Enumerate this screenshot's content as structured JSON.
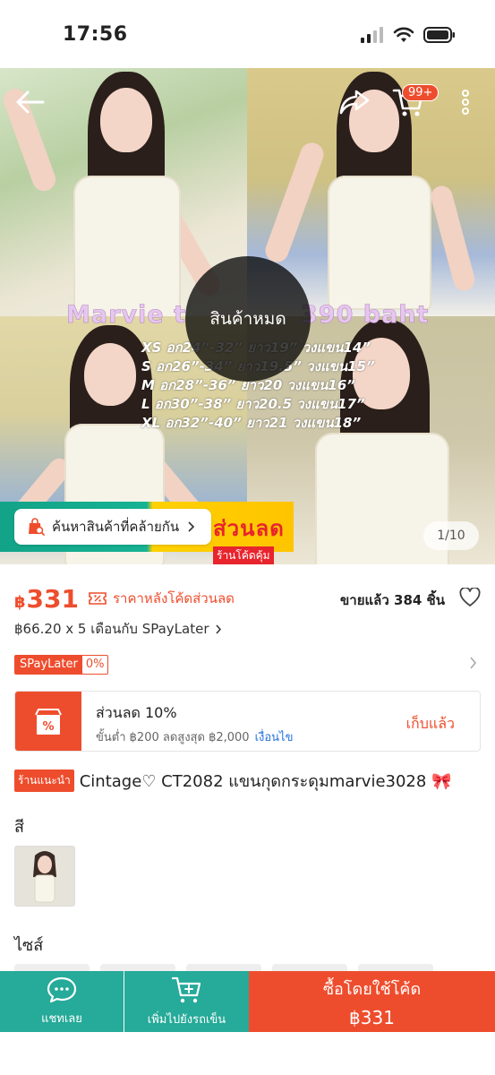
{
  "status_bar": {
    "time": "17:56"
  },
  "header": {
    "cart_count": "99+"
  },
  "gallery": {
    "overlay_title_left": "Marvie t",
    "overlay_title_right": "390 baht",
    "size_chart": [
      "XS อก24”-32” ยาว19” วงแขน14”",
      "S อก26”-34” ยาว19.5” วงแขน15”",
      "M อก28”-36” ยาว20 วงแขน16”",
      "L อก30”-38” ยาว20.5 วงแขน17”",
      "XL อก32”-40” ยาว21 วงแขน18”"
    ],
    "soldout_label": "สินค้าหมด",
    "similar_search_label": "ค้นหาสินค้าที่คล้ายกัน",
    "promo_title": "ส่วนลด",
    "promo_sub": "ร้านโค้ดคุ้ม",
    "page_indicator": "1/10"
  },
  "price": {
    "currency": "฿",
    "amount": "331",
    "note": "ราคาหลังโค้ดส่วนลด",
    "sold": "ขายแล้ว 384 ชิ้น"
  },
  "paylater": {
    "text": "฿66.20 x 5 เดือนกับ SPayLater",
    "badge_name": "SPayLater",
    "badge_rate": "0%"
  },
  "voucher": {
    "title": "ส่วนลด 10%",
    "terms": "ขั้นต่ำ ฿200 ลดสูงสุด ฿2,000",
    "terms_link": "เงื่อนไข",
    "status": "เก็บแล้ว"
  },
  "product": {
    "shop_badge": "ร้านแนะนำ",
    "title": "Cintage♡ CT2082 แขนกุดกระดุมmarvie3028 🎀"
  },
  "variants": {
    "color_label": "สี",
    "size_label": "ไซส์"
  },
  "bottom_bar": {
    "chat_label": "แชทเลย",
    "add_cart_label": "เพิ่มไปยังรถเข็น",
    "buy_label": "ซื้อโดยใช้โค้ด",
    "buy_price": "฿331"
  },
  "colors": {
    "primary": "#ee4d2d",
    "teal": "#26aa99",
    "link": "#2673dd"
  }
}
